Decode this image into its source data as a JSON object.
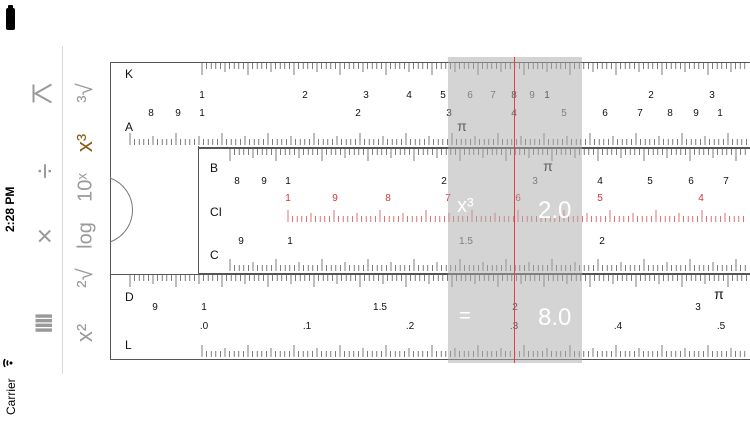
{
  "status": {
    "time": "2:28 PM",
    "carrier": "Carrier"
  },
  "toolbar": {
    "upper": [
      {
        "label": "^",
        "name": "scale-up-tool"
      },
      {
        "label": "÷",
        "name": "divide-tool"
      },
      {
        "label": "×",
        "name": "multiply-tool"
      },
      {
        "label": "IIII",
        "name": "ruler-lines-tool"
      }
    ],
    "lower": [
      {
        "label": "³√",
        "name": "cube-root-tool"
      },
      {
        "label": "x³",
        "name": "cube-tool"
      },
      {
        "label": "10ˣ",
        "name": "exp10-tool"
      },
      {
        "label": "log",
        "name": "log-tool"
      },
      {
        "label": "²√",
        "name": "square-root-tool"
      },
      {
        "label": "x²",
        "name": "square-tool"
      }
    ]
  },
  "scales": {
    "K": {
      "label": "K",
      "numbers": [
        "1",
        "2",
        "3",
        "4",
        "5",
        "6",
        "7",
        "8",
        "9",
        "1",
        "2",
        "3"
      ]
    },
    "A": {
      "label": "A",
      "numbers": [
        "8",
        "9",
        "1",
        "2",
        "3",
        "4",
        "5",
        "6",
        "7",
        "8",
        "9",
        "1"
      ],
      "pi": "π"
    },
    "B": {
      "label": "B",
      "numbers": [
        "8",
        "9",
        "1",
        "2",
        "3",
        "4",
        "5",
        "6",
        "7"
      ],
      "pi": "π"
    },
    "CI": {
      "label": "CI",
      "numbers": [
        "1",
        "9",
        "8",
        "7",
        "6",
        "5",
        "4"
      ]
    },
    "C": {
      "label": "C",
      "numbers": [
        "9",
        "1",
        "1.5",
        "2"
      ]
    },
    "D": {
      "label": "D",
      "numbers": [
        "9",
        "1",
        "1.5",
        "2",
        "3"
      ],
      "pi": "π"
    },
    "L": {
      "label": "L",
      "numbers": [
        ".0",
        ".1",
        ".2",
        ".3",
        ".4",
        ".5"
      ]
    }
  },
  "cursor": {
    "operation_top": "x³",
    "value_top": "2.0",
    "operation_bottom": "=",
    "value_bottom": "8.0"
  }
}
